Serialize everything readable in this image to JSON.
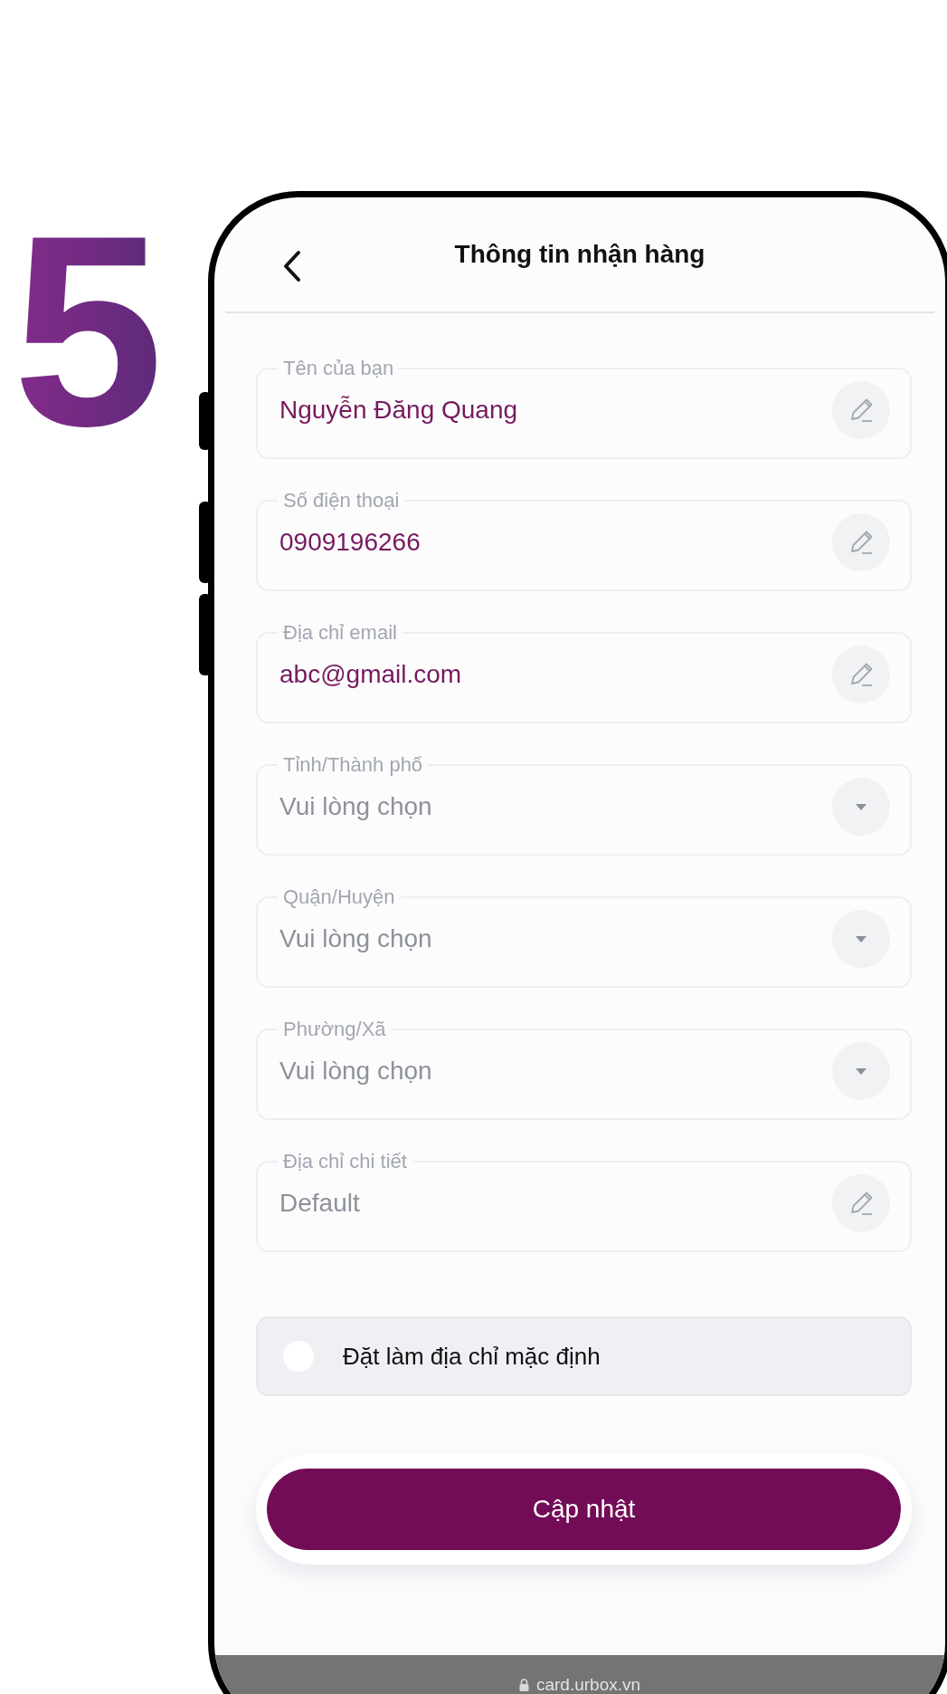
{
  "step_number": "5",
  "header": {
    "title": "Thông tin nhận hàng"
  },
  "fields": [
    {
      "kind": "text",
      "label": "Tên của bạn",
      "value": "Nguyễn Đăng Quang"
    },
    {
      "kind": "text",
      "label": "Số điện thoại",
      "value": "0909196266"
    },
    {
      "kind": "text",
      "label": "Địa chỉ email",
      "value": "abc@gmail.com"
    },
    {
      "kind": "select",
      "label": "Tỉnh/Thành phố",
      "placeholder": "Vui lòng chọn"
    },
    {
      "kind": "select",
      "label": "Quận/Huyện",
      "placeholder": "Vui lòng chọn"
    },
    {
      "kind": "select",
      "label": "Phường/Xã",
      "placeholder": "Vui lòng chọn"
    },
    {
      "kind": "text",
      "label": "Địa chỉ chi tiết",
      "placeholder": "Default"
    }
  ],
  "default_address": {
    "label": "Đặt làm địa chỉ mặc định",
    "checked": false
  },
  "submit_button": "Cập nhật",
  "url_bar": {
    "url": "card.urbox.vn"
  }
}
